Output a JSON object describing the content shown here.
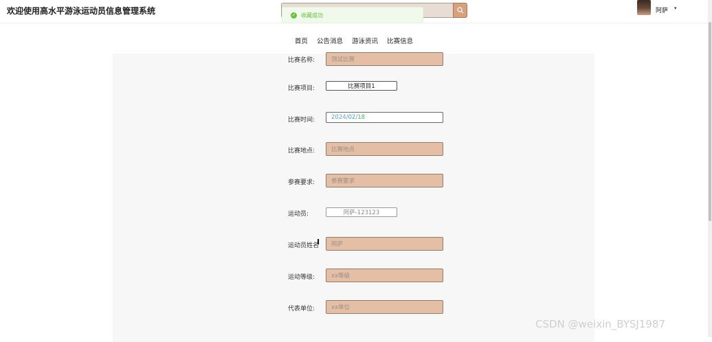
{
  "header": {
    "title": "欢迎使用高水平游泳运动员信息管理系统",
    "search_icon": "search-icon",
    "user_name": "阿萨",
    "caret": "▾"
  },
  "toast": {
    "message": "收藏成功",
    "icon": "check-circle-icon",
    "color": "#67c23a"
  },
  "nav": {
    "items": [
      "首页",
      "公告消息",
      "游泳资讯",
      "比赛信息"
    ]
  },
  "form": {
    "match_name": {
      "label": "比赛名称:",
      "placeholder": "测试比赛"
    },
    "match_item": {
      "label": "比赛项目:",
      "value": "比赛项目1"
    },
    "match_time": {
      "label": "比赛时间:",
      "year": "2024",
      "month": "02",
      "day": "18",
      "sep": "/"
    },
    "match_place": {
      "label": "比赛地点:",
      "placeholder": "比赛地点"
    },
    "requirement": {
      "label": "参赛要求:",
      "placeholder": "参赛要求"
    },
    "athlete": {
      "label": "运动员:",
      "value": "阿萨-123123"
    },
    "athlete_name": {
      "label": "运动员姓名",
      "placeholder": "阿萨"
    },
    "athlete_level": {
      "label": "运动等级:",
      "placeholder": "xx等级"
    },
    "representative_unit": {
      "label": "代表单位:",
      "placeholder": "xx单位"
    }
  },
  "colors": {
    "accent": "#d9a07e",
    "input_bg": "#e4bfa5",
    "panel_bg": "#f7f7f7"
  },
  "watermark": "CSDN @weixin_BYSJ1987"
}
